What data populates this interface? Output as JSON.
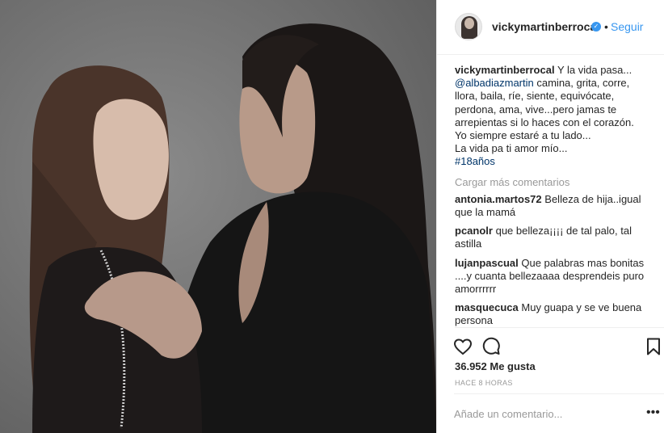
{
  "post": {
    "image_alt": "",
    "background_color": "#7c7c7c"
  },
  "header": {
    "username": "vickymartinberrocal",
    "verified_icon": "verified-badge-icon",
    "separator": "•",
    "follow_label": "Seguir",
    "follow_color": "#3897f0"
  },
  "caption": {
    "user": "vickymartinberrocal",
    "lines": [
      "Y la vida pasa...",
      "camina, grita, corre,",
      "llora, baila, ríe, siente, equivócate,",
      "perdona, ama, vive...pero jamas te",
      "arrepientas si lo haces con el corazón.",
      "Yo siempre estaré a tu lado...",
      "La vida pa ti amor mío..."
    ],
    "mention": "@albadiazmartin",
    "hashtag": "#18años"
  },
  "load_more_label": "Cargar más comentarios",
  "comments": [
    {
      "user": "antonia.martos72",
      "text": "Belleza de hija..igual que la mamá"
    },
    {
      "user": "pcanolr",
      "text": "que belleza¡¡¡¡ de tal palo, tal astilla"
    },
    {
      "user": "lujanpascual",
      "text": "Que palabras mas bonitas ....y cuanta bellezaaaa desprendeis puro amorrrrrr"
    },
    {
      "user": "masquecuca",
      "text": "Muy guapa y se ve buena persona"
    }
  ],
  "actions": {
    "like_icon": "heart-icon",
    "comment_icon": "comment-icon",
    "save_icon": "bookmark-icon",
    "likes": "36.952 Me gusta",
    "time": "HACE 8 HORAS"
  },
  "add_comment": {
    "placeholder": "Añade un comentario...",
    "more_label": "•••"
  }
}
